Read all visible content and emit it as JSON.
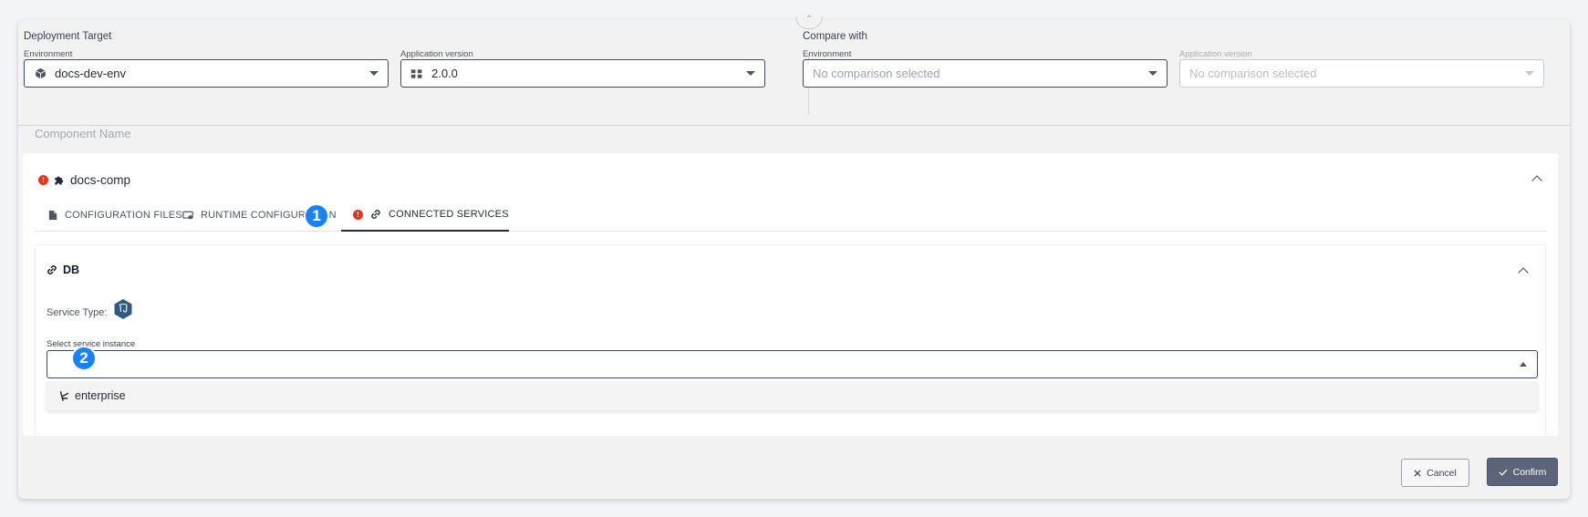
{
  "deployment": {
    "title": "Deployment Target",
    "environment": {
      "label": "Environment",
      "value": "docs-dev-env"
    },
    "app_version": {
      "label": "Application version",
      "value": "2.0.0"
    }
  },
  "compare": {
    "title": "Compare with",
    "environment": {
      "label": "Environment",
      "placeholder": "No comparison selected"
    },
    "app_version": {
      "label": "Application version",
      "placeholder": "No comparison selected"
    }
  },
  "components": {
    "header_label": "Component Name",
    "component": {
      "name": "docs-comp",
      "tabs": [
        {
          "label": "CONFIGURATION FILES",
          "icon": "file-icon"
        },
        {
          "label": "RUNTIME CONFIGURATION",
          "icon": "runtime-icon"
        },
        {
          "label": "CONNECTED SERVICES",
          "icon": "link-icon",
          "active": true
        }
      ],
      "service": {
        "name": "DB",
        "type_label": "Service Type:",
        "instance_label": "Select service instance",
        "options": [
          "enterprise"
        ]
      }
    }
  },
  "annotations": [
    "1",
    "2"
  ],
  "actions": {
    "cancel": "Cancel",
    "confirm": "Confirm"
  },
  "colors": {
    "accent": "#1a82f7",
    "error": "#e5341c",
    "confirm_bg": "#5b6478",
    "border": "#3b4a63"
  }
}
